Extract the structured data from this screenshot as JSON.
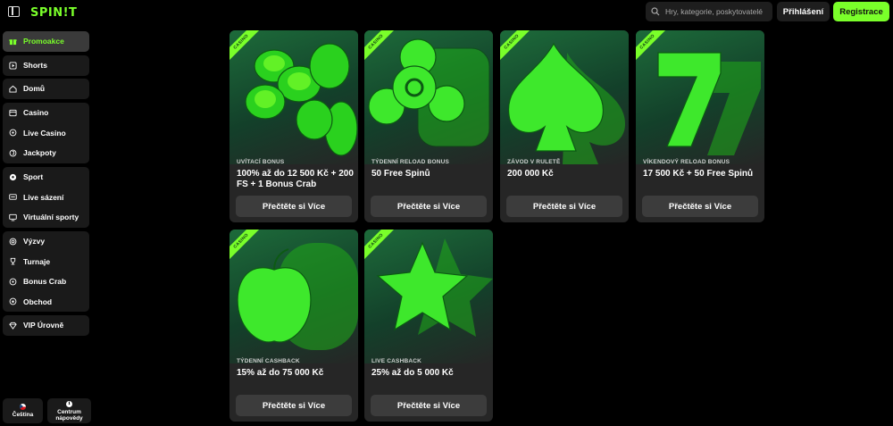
{
  "header": {
    "logo": "SPIN!T",
    "search_placeholder": "Hry, kategorie, poskytovatelé",
    "login_label": "Přihlášení",
    "register_label": "Registrace"
  },
  "sidebar": {
    "groups": [
      [
        {
          "label": "Promoakce",
          "icon": "gift-icon",
          "active": true
        }
      ],
      [
        {
          "label": "Shorts",
          "icon": "play-icon"
        }
      ],
      [
        {
          "label": "Domů",
          "icon": "home-icon"
        }
      ],
      [
        {
          "label": "Casino",
          "icon": "slot-machine-icon"
        },
        {
          "label": "Live Casino",
          "icon": "live-icon"
        },
        {
          "label": "Jackpoty",
          "icon": "jackpot-icon"
        }
      ],
      [
        {
          "label": "Sport",
          "icon": "ball-icon"
        },
        {
          "label": "Live sázení",
          "icon": "live-betting-icon"
        },
        {
          "label": "Virtuální sporty",
          "icon": "monitor-icon"
        }
      ],
      [
        {
          "label": "Výzvy",
          "icon": "challenge-icon"
        },
        {
          "label": "Turnaje",
          "icon": "trophy-icon"
        },
        {
          "label": "Bonus Crab",
          "icon": "crab-icon"
        },
        {
          "label": "Obchod",
          "icon": "shop-icon"
        }
      ],
      [
        {
          "label": "VIP Úrovně",
          "icon": "diamond-icon"
        }
      ]
    ],
    "footer": {
      "language": "Čeština",
      "help_center": "Centrum nápovědy"
    }
  },
  "promotions": [
    {
      "ribbon": "CASINO",
      "tag": "UVÍTACÍ BONUS",
      "title": "100% až do 12 500 Kč + 200 FS + 1 Bonus Crab",
      "button": "Přečtěte si Více",
      "art": "chips-icon"
    },
    {
      "ribbon": "CASINO",
      "tag": "TÝDENNÍ RELOAD BONUS",
      "title": "50 Free Spinů",
      "button": "Přečtěte si Více",
      "art": "spinner-icon"
    },
    {
      "ribbon": "CASINO",
      "tag": "ZÁVOD V RULETĚ",
      "title": "200 000 Kč",
      "button": "Přečtěte si Více",
      "art": "spade-icon"
    },
    {
      "ribbon": "CASINO",
      "tag": "VÍKENDOVÝ RELOAD BONUS",
      "title": "17 500 Kč + 50 Free Spinů",
      "button": "Přečtěte si Více",
      "art": "seven-icon"
    },
    {
      "ribbon": "CASINO",
      "tag": "TÝDENNÍ CASHBACK",
      "title": "15% až do 75 000 Kč",
      "button": "Přečtěte si Více",
      "art": "apple-icon"
    },
    {
      "ribbon": "CASINO",
      "tag": "LIVE CASHBACK",
      "title": "25% až do 5 000 Kč",
      "button": "Přečtěte si Více",
      "art": "star-icon"
    }
  ],
  "colors": {
    "accent": "#7aff2a",
    "background": "#000000",
    "surface": "#1a1a1a",
    "card": "#262626"
  }
}
